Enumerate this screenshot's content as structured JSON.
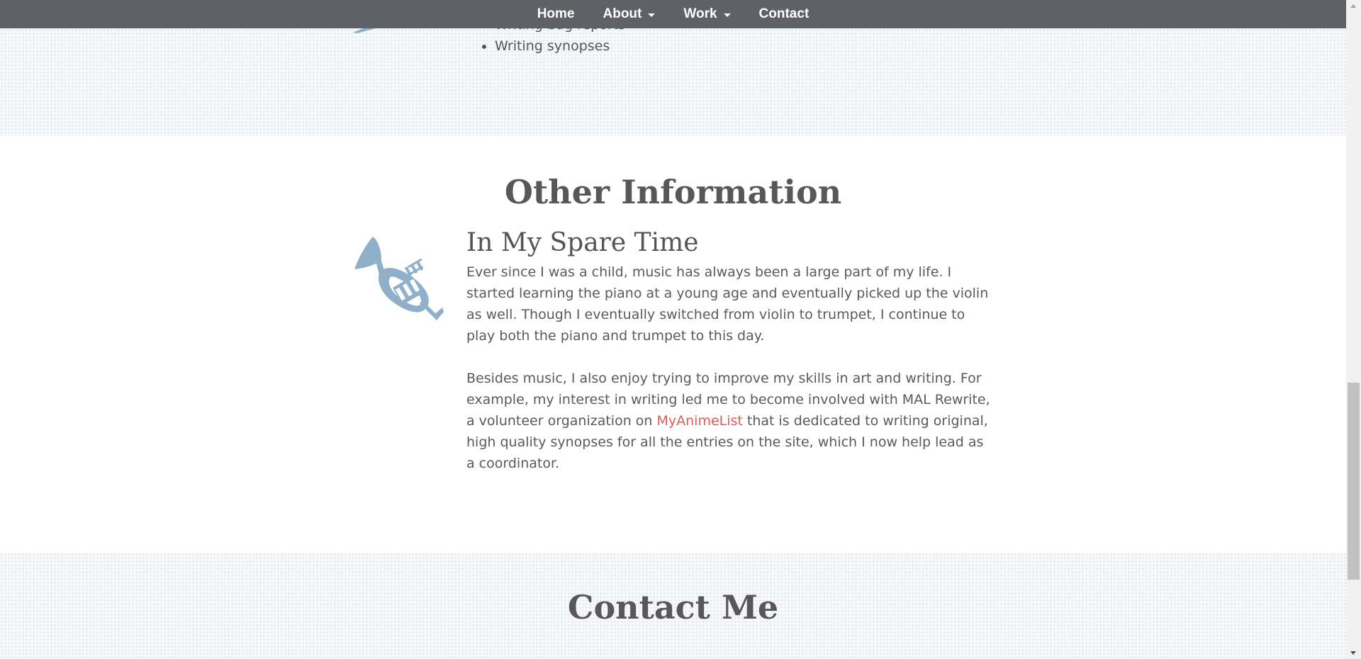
{
  "nav": {
    "home": "Home",
    "about": "About",
    "work": "Work",
    "contact": "Contact"
  },
  "top_list": {
    "items": [
      "Writing bug reports",
      "Writing synopses"
    ]
  },
  "other": {
    "title": "Other Information",
    "spare_title": "In My Spare Time",
    "para1": "Ever since I was a child, music has always been a large part of my life. I started learning the piano at a young age and eventually picked up the violin as well. Though I eventually switched from violin to trumpet, I continue to play both the piano and trumpet to this day.",
    "para2_before": "Besides music, I also enjoy trying to improve my skills in art and writing. For example, my interest in writing led me to become involved with MAL Rewrite, a volunteer organization on ",
    "para2_link": "MyAnimeList",
    "para2_after": " that is dedicated to writing original, high quality synopses for all the entries on the site, which I now help lead as a coordinator."
  },
  "contact": {
    "title": "Contact Me"
  },
  "icons": {
    "trumpet": "trumpet-icon",
    "partial": "partial-icon"
  },
  "colors": {
    "navbar": "#5f6166",
    "icon": "#8fb0c8",
    "link": "#e05b5b",
    "text": "#555555"
  }
}
